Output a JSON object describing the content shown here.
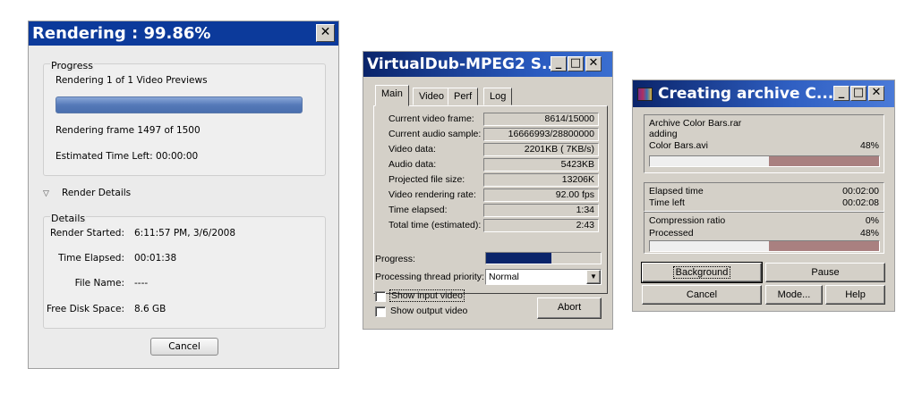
{
  "rendering": {
    "title": "Rendering : 99.86%",
    "close_glyph": "✕",
    "progress_group_label": "Progress",
    "status": "Rendering 1 of 1 Video Previews",
    "progress_fraction": 0.9986,
    "frame_text": "Rendering frame 1497 of 1500",
    "time_left": "Estimated Time Left: 00:00:00",
    "details_toggle": "Render Details",
    "details_group_label": "Details",
    "details": [
      {
        "label": "Render Started:",
        "value": "6:11:57 PM, 3/6/2008"
      },
      {
        "label": "Time Elapsed:",
        "value": "00:01:38"
      },
      {
        "label": "File Name:",
        "value": "----"
      },
      {
        "label": "Free Disk Space:",
        "value": "8.6 GB"
      }
    ],
    "cancel_label": "Cancel"
  },
  "vdub": {
    "title": "VirtualDub-MPEG2 S...",
    "tabs": [
      "Main",
      "Video",
      "Perf",
      "Log"
    ],
    "active_tab": "Main",
    "rows": [
      {
        "label": "Current video frame:",
        "value": "8614/15000"
      },
      {
        "label": "Current audio sample:",
        "value": "16666993/28800000"
      },
      {
        "label": "Video data:",
        "value": "2201KB ( 7KB/s)"
      },
      {
        "label": "Audio data:",
        "value": "5423KB"
      },
      {
        "label": "Projected file size:",
        "value": "13206K"
      },
      {
        "label": "Video rendering rate:",
        "value": "92.00 fps"
      },
      {
        "label": "Time elapsed:",
        "value": "1:34"
      },
      {
        "label": "Total time (estimated):",
        "value": "2:43"
      }
    ],
    "progress_label": "Progress:",
    "progress_fraction": 0.574,
    "priority_label": "Processing thread priority:",
    "priority_value": "Normal",
    "show_input": "Show input video",
    "show_output": "Show output video",
    "abort_label": "Abort",
    "accent_color": "#0a246a"
  },
  "winrar": {
    "title": "Creating archive C...",
    "archive_name": "Archive Color Bars.rar",
    "action": "adding",
    "file_name": "Color Bars.avi",
    "file_percent": "48%",
    "file_fraction": 0.48,
    "elapsed_label": "Elapsed time",
    "elapsed_value": "00:02:00",
    "left_label": "Time left",
    "left_value": "00:02:08",
    "ratio_label": "Compression ratio",
    "ratio_value": "0%",
    "processed_label": "Processed",
    "processed_value": "48%",
    "processed_fraction": 0.48,
    "buttons": {
      "background": "Background",
      "pause": "Pause",
      "cancel": "Cancel",
      "mode": "Mode...",
      "help": "Help"
    },
    "bar_color": "#a98080"
  }
}
